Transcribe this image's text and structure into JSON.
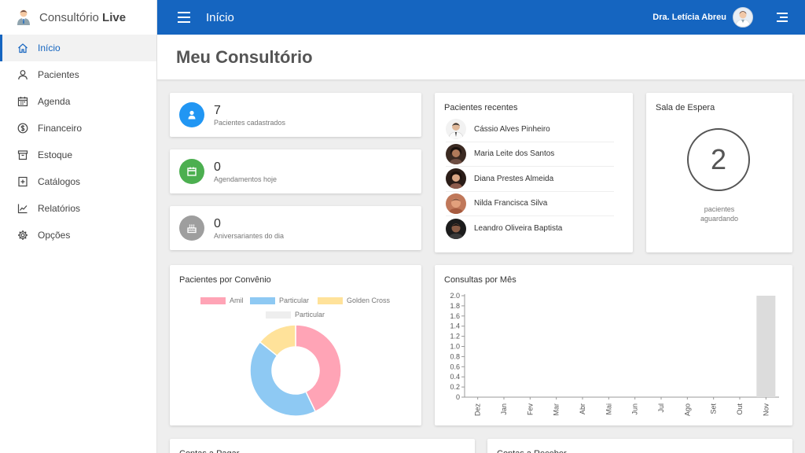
{
  "brand": {
    "name": "Consultório",
    "name_bold": "Live"
  },
  "sidebar": {
    "items": [
      {
        "label": "Início",
        "icon": "home-icon",
        "active": true
      },
      {
        "label": "Pacientes",
        "icon": "user-icon",
        "active": false
      },
      {
        "label": "Agenda",
        "icon": "calendar-icon",
        "active": false
      },
      {
        "label": "Financeiro",
        "icon": "dollar-icon",
        "active": false
      },
      {
        "label": "Estoque",
        "icon": "archive-icon",
        "active": false
      },
      {
        "label": "Catálogos",
        "icon": "plus-square-icon",
        "active": false
      },
      {
        "label": "Relatórios",
        "icon": "chart-line-icon",
        "active": false
      },
      {
        "label": "Opções",
        "icon": "gear-icon",
        "active": false
      }
    ]
  },
  "topbar": {
    "title": "Início",
    "user_name": "Dra. Letícia Abreu",
    "color": "#1565c0"
  },
  "page": {
    "title": "Meu Consultório"
  },
  "stats": [
    {
      "value": "7",
      "label": "Pacientes cadastrados",
      "color": "#2196f3",
      "icon": "user-icon"
    },
    {
      "value": "0",
      "label": "Agendamentos hoje",
      "color": "#4caf50",
      "icon": "calendar-icon"
    },
    {
      "value": "0",
      "label": "Aniversariantes do dia",
      "color": "#9e9e9e",
      "icon": "cake-icon"
    }
  ],
  "recent": {
    "title": "Pacientes recentes",
    "patients": [
      {
        "name": "Cássio Alves Pinheiro"
      },
      {
        "name": "Maria Leite dos Santos"
      },
      {
        "name": "Diana Prestes Almeida"
      },
      {
        "name": "Nilda Francisca Silva"
      },
      {
        "name": "Leandro Oliveira Baptista"
      }
    ]
  },
  "waiting": {
    "title": "Sala de Espera",
    "count": "2",
    "label_line1": "pacientes",
    "label_line2": "aguardando"
  },
  "convenio": {
    "title": "Pacientes por Convênio"
  },
  "consultas": {
    "title": "Consultas por Mês"
  },
  "bottom": {
    "left_title": "Contas a Pagar",
    "right_title": "Contas a Receber"
  },
  "chart_data": [
    {
      "type": "pie",
      "title": "Pacientes por Convênio",
      "labels": [
        "Amil",
        "Particular",
        "Golden Cross",
        "Particular"
      ],
      "values": [
        3,
        3,
        1,
        0
      ],
      "colors": [
        "#ffa4b6",
        "#8ec9f3",
        "#ffe29a",
        "#eeeeee"
      ],
      "legend": "top"
    },
    {
      "type": "bar",
      "title": "Consultas por Mês",
      "categories": [
        "Dez",
        "Jan",
        "Fev",
        "Mar",
        "Abr",
        "Mai",
        "Jun",
        "Jul",
        "Ago",
        "Set",
        "Out",
        "Nov"
      ],
      "values": [
        0,
        0,
        0,
        0,
        0,
        0,
        0,
        0,
        0,
        0,
        0,
        2
      ],
      "ylim": [
        0,
        2
      ],
      "yticks": [
        "0",
        "0.2",
        "0.4",
        "0.6",
        "0.8",
        "1.0",
        "1.2",
        "1.4",
        "1.6",
        "1.8",
        "2.0"
      ],
      "color": "#dcdcdc",
      "xlabel": "",
      "ylabel": "",
      "grid": false
    }
  ]
}
